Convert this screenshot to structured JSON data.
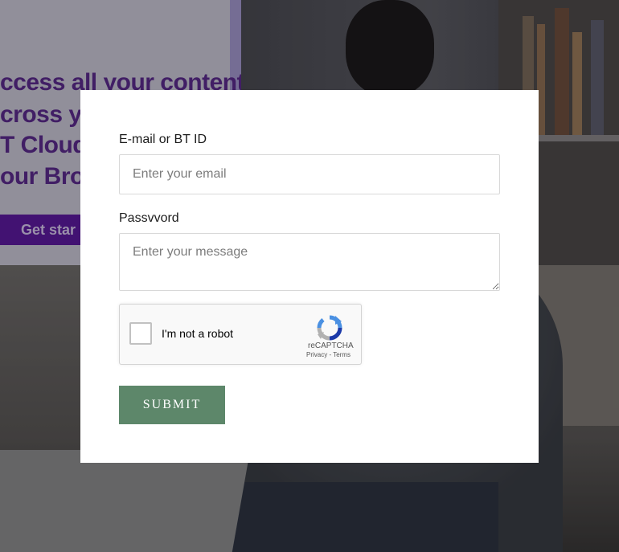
{
  "background": {
    "banner_lines": [
      "ccess all your content",
      "cross yo",
      "T Cloud",
      "our Broc"
    ],
    "banner_button_label": "Get star"
  },
  "form": {
    "email_label": "E-mail or BT ID",
    "email_placeholder": "Enter your email",
    "email_value": "",
    "password_label": "Passvvord",
    "password_placeholder": "Enter your message",
    "password_value": "",
    "submit_label": "SUBMIT",
    "submit_color": "#5d876a"
  },
  "captcha": {
    "checkbox_label": "I'm not a robot",
    "checked": false,
    "brand": "reCAPTCHA",
    "privacy_link": "Privacy",
    "separator": " - ",
    "terms_link": "Terms",
    "icon": "recaptcha-logo-icon"
  }
}
